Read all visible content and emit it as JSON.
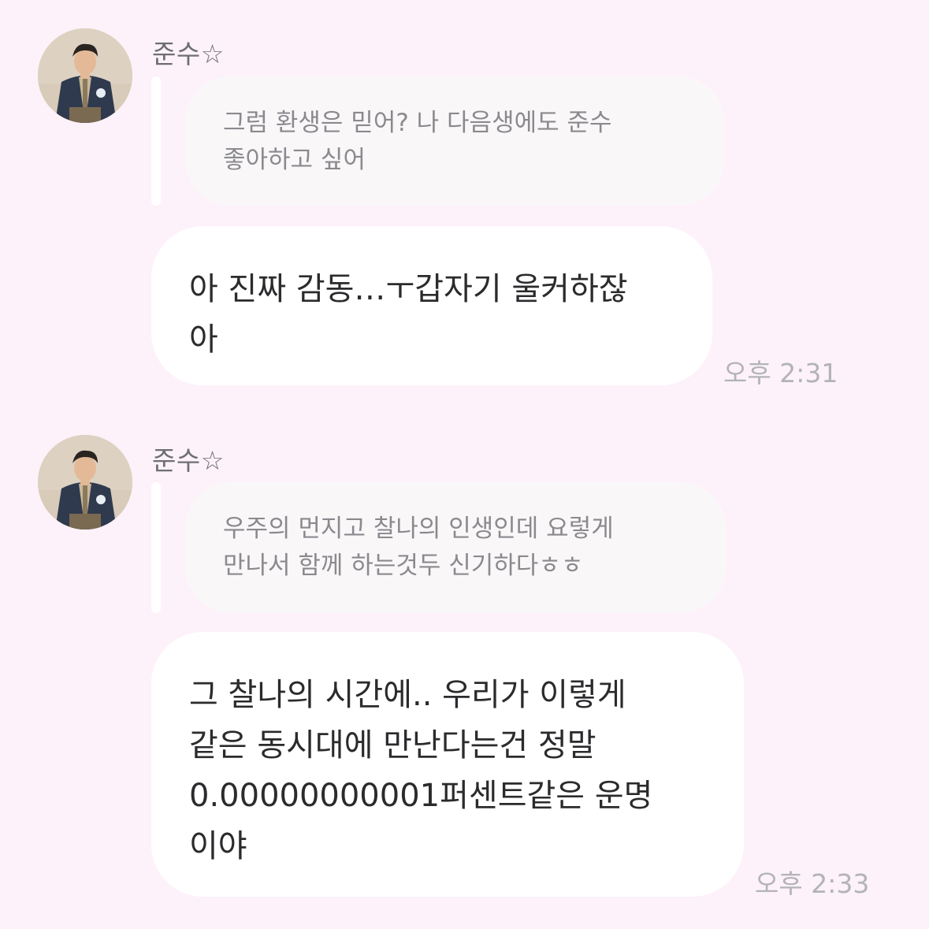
{
  "messages": [
    {
      "sender": "준수☆",
      "quote_lines": [
        "그럼 환생은 믿어? 나 다음생에도 준수",
        "좋아하고 싶어"
      ],
      "reply_lines": [
        "아 진짜 감동…ㅜ갑자기 울커하잖",
        "아"
      ],
      "time": "오후 2:31"
    },
    {
      "sender": "준수☆",
      "quote_lines": [
        "우주의 먼지고 찰나의 인생인데 요렇게",
        "만나서 함께 하는것두 신기하다ㅎㅎ"
      ],
      "reply_lines": [
        "그 찰나의 시간에.. 우리가 이렇게",
        "같은 동시대에 만난다는건 정말",
        "0.00000000001퍼센트같은 운명",
        "이야"
      ],
      "time": "오후 2:33"
    }
  ],
  "colors": {
    "background": "#fdf2f9",
    "bubble": "#ffffff",
    "quote_bubble": "#faf7f9",
    "timestamp": "#b3b3b8"
  },
  "icons": {
    "avatar": "profile-photo"
  }
}
